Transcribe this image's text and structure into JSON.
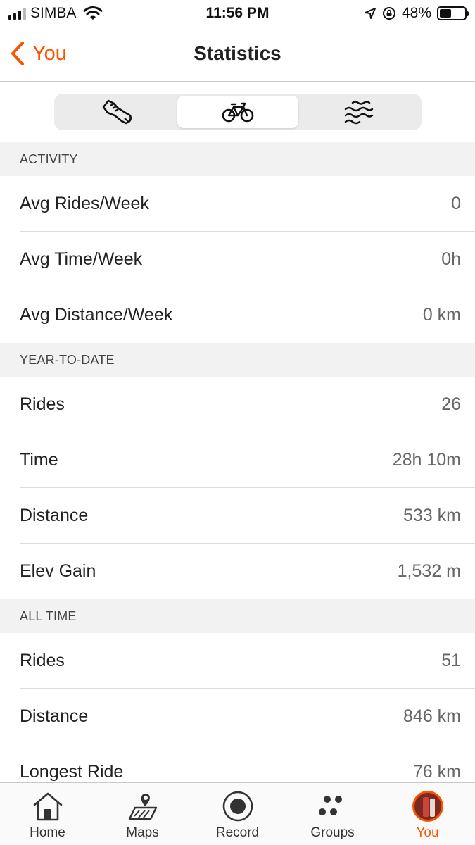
{
  "status_bar": {
    "carrier": "SIMBA",
    "time": "11:56 PM",
    "battery_percent": "48%",
    "battery_level": 0.48
  },
  "nav": {
    "back_label": "You",
    "title": "Statistics"
  },
  "sport_tabs": [
    {
      "icon": "running-shoe-icon",
      "active": false
    },
    {
      "icon": "bicycle-icon",
      "active": true
    },
    {
      "icon": "waves-icon",
      "active": false
    }
  ],
  "sections": {
    "activity": {
      "header": "ACTIVITY",
      "rows": [
        {
          "label": "Avg Rides/Week",
          "value": "0"
        },
        {
          "label": "Avg Time/Week",
          "value": "0h"
        },
        {
          "label": "Avg Distance/Week",
          "value": "0 km"
        }
      ]
    },
    "ytd": {
      "header": "YEAR-TO-DATE",
      "rows": [
        {
          "label": "Rides",
          "value": "26"
        },
        {
          "label": "Time",
          "value": "28h 10m"
        },
        {
          "label": "Distance",
          "value": "533 km"
        },
        {
          "label": "Elev Gain",
          "value": "1,532 m"
        }
      ]
    },
    "all_time": {
      "header": "ALL TIME",
      "rows": [
        {
          "label": "Rides",
          "value": "51"
        },
        {
          "label": "Distance",
          "value": "846 km"
        },
        {
          "label": "Longest Ride",
          "value": "76 km"
        }
      ]
    }
  },
  "tab_bar": [
    {
      "label": "Home",
      "icon": "home-icon",
      "active": false
    },
    {
      "label": "Maps",
      "icon": "map-icon",
      "active": false
    },
    {
      "label": "Record",
      "icon": "record-icon",
      "active": false
    },
    {
      "label": "Groups",
      "icon": "groups-icon",
      "active": false
    },
    {
      "label": "You",
      "icon": "avatar",
      "active": true
    }
  ],
  "colors": {
    "accent": "#fc5200",
    "section_bg": "#f2f2f2",
    "divider": "#dcdcdc"
  }
}
